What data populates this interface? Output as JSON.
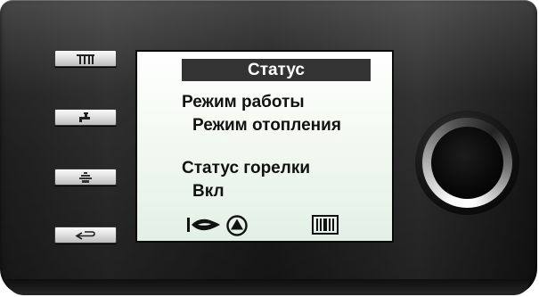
{
  "side_buttons": [
    {
      "icon": "radiator-icon"
    },
    {
      "icon": "faucet-icon"
    },
    {
      "icon": "settings-stack-icon"
    },
    {
      "icon": "back-arrow-icon"
    }
  ],
  "screen": {
    "title": "Статус",
    "rows": [
      {
        "label": "Режим работы",
        "value": "Режим отопления"
      },
      {
        "label": "Статус горелки",
        "value": "Вкл"
      }
    ],
    "status_icons": [
      "burner-flame-icon",
      "pump-icon",
      "radiator-status-icon"
    ]
  },
  "knob": {
    "icon": "rotary-knob"
  },
  "colors": {
    "housing": "#1f1f1f",
    "screen_bg": "#f2f9f1",
    "title_bg": "#333333",
    "text": "#111111"
  }
}
